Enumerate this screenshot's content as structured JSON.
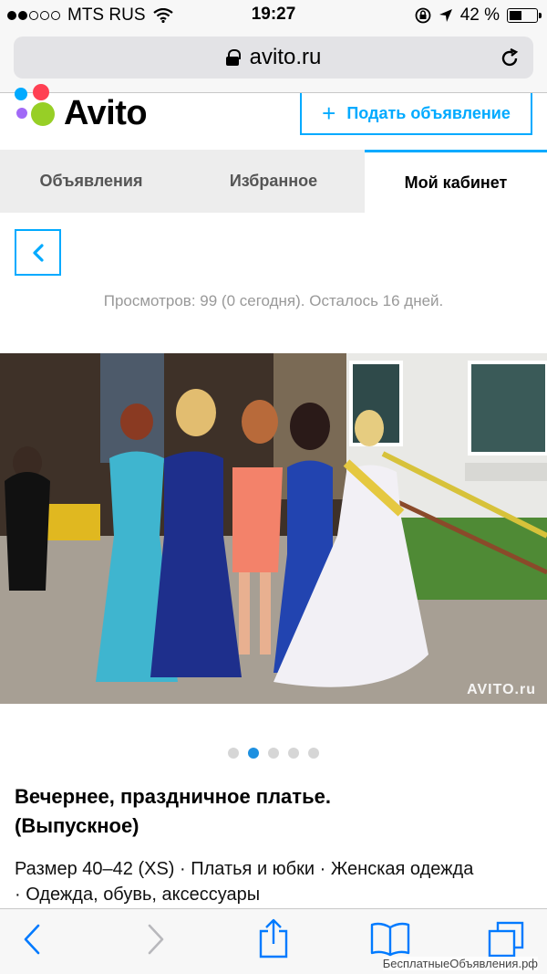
{
  "status_bar": {
    "carrier": "MTS RUS",
    "time": "19:27",
    "battery": "42 %",
    "battery_level": 0.42,
    "signal_filled_dots": 2,
    "signal_total_dots": 5
  },
  "browser": {
    "url": "avito.ru"
  },
  "header": {
    "logo_text": "Avito",
    "post_button_label": "Подать объявление"
  },
  "tabs": [
    {
      "label": "Объявления",
      "active": false
    },
    {
      "label": "Избранное",
      "active": false
    },
    {
      "label": "Мой кабинет",
      "active": true
    }
  ],
  "listing": {
    "views_text": "Просмотров: 99 (0 сегодня). Осталось 16 дней.",
    "photo_watermark": "AVITO.ru",
    "pager_total": 5,
    "pager_active": 2,
    "title_line1": "Вечернее, праздничное платье.",
    "title_line2": "(Выпускное)",
    "categories_line1": "Размер 40–42 (XS) · Платья и юбки · Женская одежда",
    "categories_line2": " · Одежда, обувь, аксессуары"
  },
  "toolbar": {
    "icons": [
      "back-icon",
      "forward-icon",
      "share-icon",
      "bookmarks-icon",
      "tabs-icon"
    ],
    "site_credit": "БесплатныеОбъявления.рф"
  },
  "colors": {
    "accent": "#00aaff",
    "pager_active": "#1e90e0",
    "ios_blue": "#007aff"
  }
}
